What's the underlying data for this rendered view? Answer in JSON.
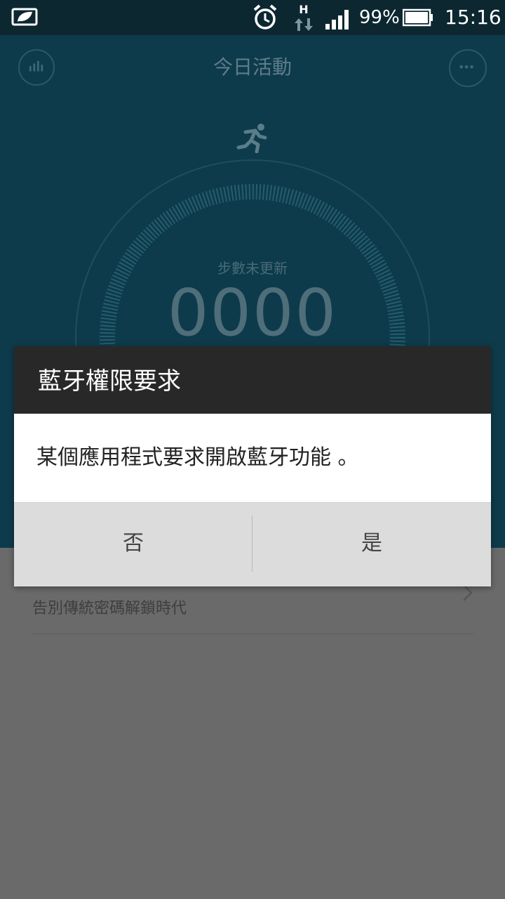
{
  "status_bar": {
    "battery_percent": "99%",
    "time": "15:16",
    "network_type": "H",
    "icons": [
      "leaf-battery-saver-icon",
      "alarm-icon",
      "data-arrows-icon",
      "signal-icon",
      "battery-icon"
    ]
  },
  "app": {
    "title": "今日活動",
    "steps_label": "步數未更新",
    "steps_value": "0000",
    "list": {
      "subtitle": "告別傳統密碼解鎖時代"
    },
    "colors": {
      "background": "#0d3b4b",
      "accent": "#4f6e7a"
    }
  },
  "dialog": {
    "title": "藍牙權限要求",
    "message": "某個應用程式要求開啟藍牙功能 。",
    "no_label": "否",
    "yes_label": "是"
  }
}
